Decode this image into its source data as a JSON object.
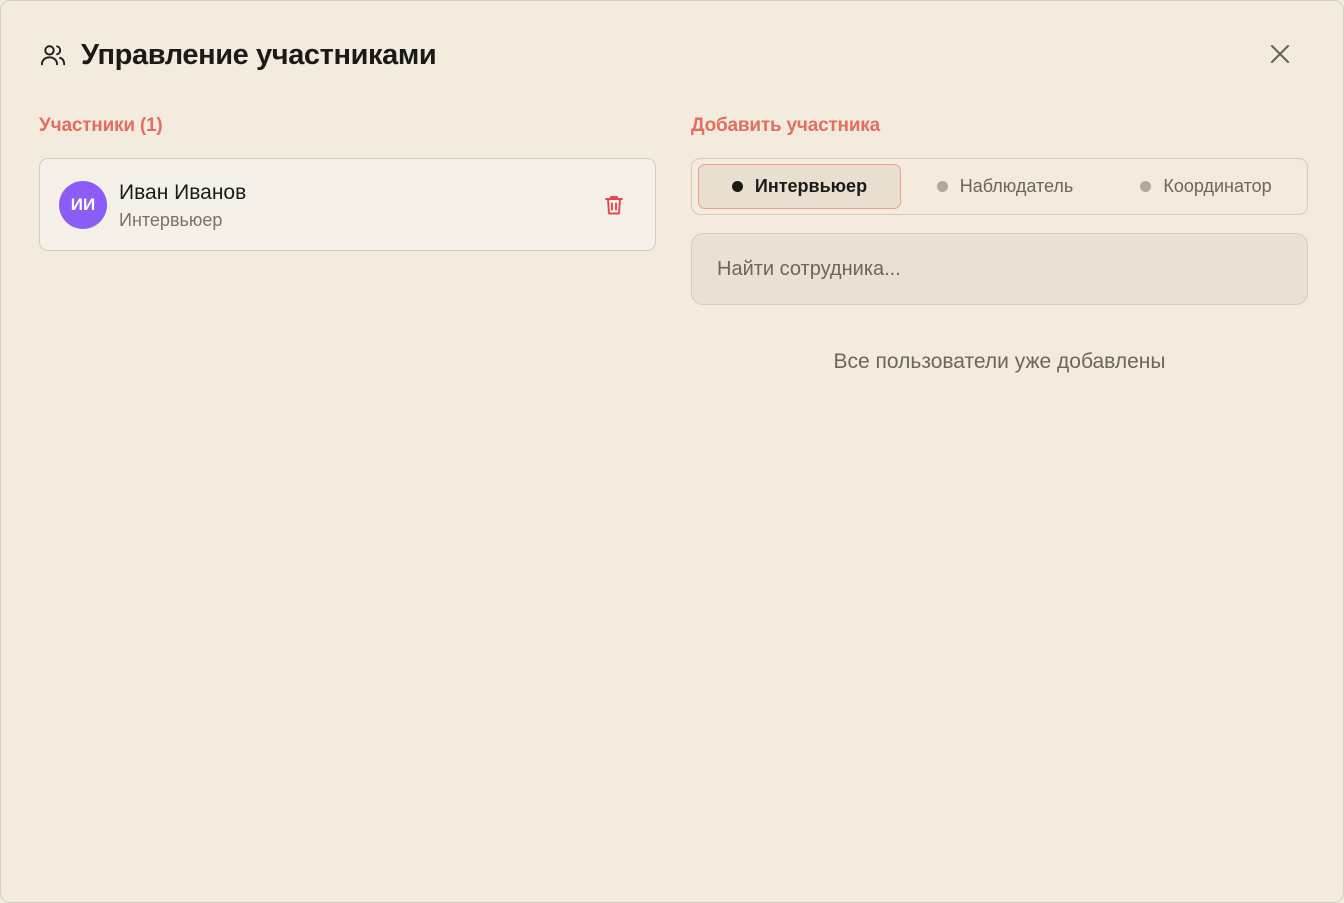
{
  "dialog": {
    "title": "Управление участниками",
    "icon": "users-icon",
    "close_icon": "close-icon"
  },
  "participants": {
    "heading": "Участники (1)",
    "items": [
      {
        "initials": "ИИ",
        "name": "Иван Иванов",
        "role": "Интервьюер",
        "avatar_color": "#8b5cf6",
        "delete_icon": "trash-icon"
      }
    ]
  },
  "add": {
    "heading": "Добавить участника",
    "roles": [
      {
        "label": "Интервьюер",
        "selected": true
      },
      {
        "label": "Наблюдатель",
        "selected": false
      },
      {
        "label": "Координатор",
        "selected": false
      }
    ],
    "search": {
      "placeholder": "Найти сотрудника...",
      "value": ""
    },
    "empty_message": "Все пользователи уже добавлены"
  },
  "colors": {
    "accent": "#e36f5e",
    "background": "#f2ebde",
    "delete": "#e5484d"
  }
}
